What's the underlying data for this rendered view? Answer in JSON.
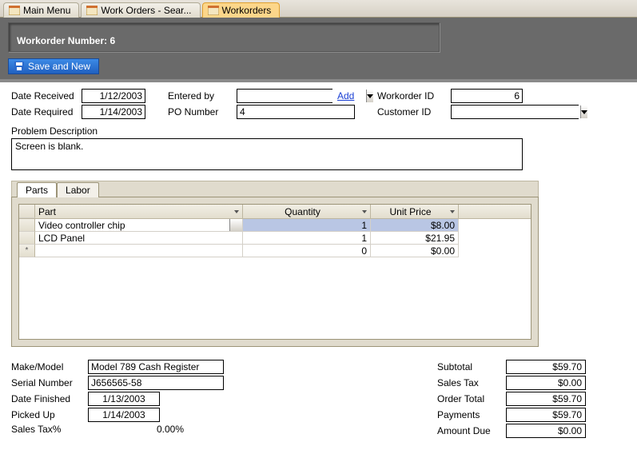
{
  "doc_tabs": [
    "Main Menu",
    "Work Orders - Sear...",
    "Workorders"
  ],
  "active_doc_tab": 2,
  "title_prefix": "Workorder Number: ",
  "title_number": "6",
  "save_btn": "Save and New",
  "fields": {
    "date_received_lbl": "Date Received",
    "date_received": "1/12/2003",
    "date_required_lbl": "Date Required",
    "date_required": "1/14/2003",
    "entered_by_lbl": "Entered by",
    "entered_by": "",
    "add_link": "Add",
    "po_number_lbl": "PO Number",
    "po_number": "4",
    "workorder_id_lbl": "Workorder ID",
    "workorder_id": "6",
    "customer_id_lbl": "Customer ID",
    "customer_id": ""
  },
  "problem_lbl": "Problem Description",
  "problem_text": "Screen is blank.",
  "sub_tabs": [
    "Parts",
    "Labor"
  ],
  "active_sub_tab": 0,
  "columns": {
    "part": "Part",
    "qty": "Quantity",
    "price": "Unit Price"
  },
  "chart_data": {
    "type": "table",
    "columns": [
      "Part",
      "Quantity",
      "Unit Price"
    ],
    "rows": [
      {
        "part": "Video controller chip",
        "qty": 1,
        "price": "$8.00",
        "selected": true
      },
      {
        "part": "LCD Panel",
        "qty": 1,
        "price": "$21.95"
      },
      {
        "part": "",
        "qty": 0,
        "price": "$0.00",
        "new": true
      }
    ]
  },
  "footer_left": {
    "make_lbl": "Make/Model",
    "make": "Model 789 Cash Register",
    "serial_lbl": "Serial Number",
    "serial": "J656565-58",
    "finished_lbl": "Date Finished",
    "finished": "1/13/2003",
    "picked_lbl": "Picked Up",
    "picked": "1/14/2003",
    "tax_pct_lbl": "Sales Tax%",
    "tax_pct": "0.00%"
  },
  "footer_right": {
    "subtotal_lbl": "Subtotal",
    "subtotal": "$59.70",
    "salestax_lbl": "Sales Tax",
    "salestax": "$0.00",
    "total_lbl": "Order Total",
    "total": "$59.70",
    "payments_lbl": "Payments",
    "payments": "$59.70",
    "due_lbl": "Amount Due",
    "due": "$0.00"
  }
}
